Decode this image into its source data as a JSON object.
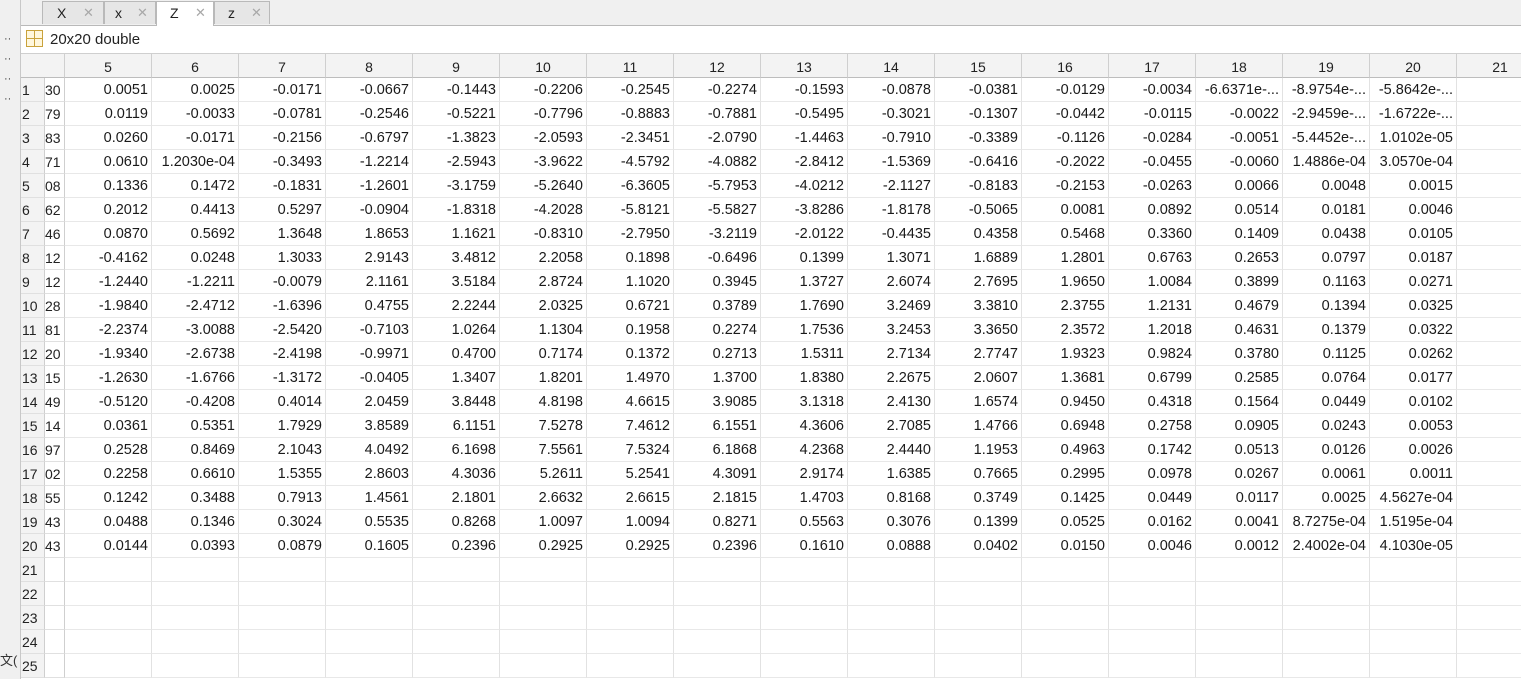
{
  "tabs": [
    {
      "label": "X",
      "active": false
    },
    {
      "label": "x",
      "active": false
    },
    {
      "label": "Z",
      "active": true
    },
    {
      "label": "z",
      "active": false
    }
  ],
  "variable": {
    "description": "20x20 double"
  },
  "left_panel": {
    "partial_label": "文("
  },
  "columns": [
    "5",
    "6",
    "7",
    "8",
    "9",
    "10",
    "11",
    "12",
    "13",
    "14",
    "15",
    "16",
    "17",
    "18",
    "19",
    "20",
    "21"
  ],
  "row_headers": [
    "1",
    "2",
    "3",
    "4",
    "5",
    "6",
    "7",
    "8",
    "9",
    "10",
    "11",
    "12",
    "13",
    "14",
    "15",
    "16",
    "17",
    "18",
    "19",
    "20",
    "21",
    "22",
    "23",
    "24",
    "25"
  ],
  "fragment_column": [
    "30",
    "79",
    "83",
    "71",
    "08",
    "62",
    "46",
    "12",
    "12",
    "28",
    "81",
    "20",
    "15",
    "49",
    "14",
    "97",
    "02",
    "55",
    "43",
    "43",
    "",
    "",
    "",
    "",
    ""
  ],
  "rows": [
    [
      "0.0051",
      "0.0025",
      "-0.0171",
      "-0.0667",
      "-0.1443",
      "-0.2206",
      "-0.2545",
      "-0.2274",
      "-0.1593",
      "-0.0878",
      "-0.0381",
      "-0.0129",
      "-0.0034",
      "-6.6371e-...",
      "-8.9754e-...",
      "-5.8642e-...",
      ""
    ],
    [
      "0.0119",
      "-0.0033",
      "-0.0781",
      "-0.2546",
      "-0.5221",
      "-0.7796",
      "-0.8883",
      "-0.7881",
      "-0.5495",
      "-0.3021",
      "-0.1307",
      "-0.0442",
      "-0.0115",
      "-0.0022",
      "-2.9459e-...",
      "-1.6722e-...",
      ""
    ],
    [
      "0.0260",
      "-0.0171",
      "-0.2156",
      "-0.6797",
      "-1.3823",
      "-2.0593",
      "-2.3451",
      "-2.0790",
      "-1.4463",
      "-0.7910",
      "-0.3389",
      "-0.1126",
      "-0.0284",
      "-0.0051",
      "-5.4452e-...",
      "1.0102e-05",
      ""
    ],
    [
      "0.0610",
      "1.2030e-04",
      "-0.3493",
      "-1.2214",
      "-2.5943",
      "-3.9622",
      "-4.5792",
      "-4.0882",
      "-2.8412",
      "-1.5369",
      "-0.6416",
      "-0.2022",
      "-0.0455",
      "-0.0060",
      "1.4886e-04",
      "3.0570e-04",
      ""
    ],
    [
      "0.1336",
      "0.1472",
      "-0.1831",
      "-1.2601",
      "-3.1759",
      "-5.2640",
      "-6.3605",
      "-5.7953",
      "-4.0212",
      "-2.1127",
      "-0.8183",
      "-0.2153",
      "-0.0263",
      "0.0066",
      "0.0048",
      "0.0015",
      ""
    ],
    [
      "0.2012",
      "0.4413",
      "0.5297",
      "-0.0904",
      "-1.8318",
      "-4.2028",
      "-5.8121",
      "-5.5827",
      "-3.8286",
      "-1.8178",
      "-0.5065",
      "0.0081",
      "0.0892",
      "0.0514",
      "0.0181",
      "0.0046",
      ""
    ],
    [
      "0.0870",
      "0.5692",
      "1.3648",
      "1.8653",
      "1.1621",
      "-0.8310",
      "-2.7950",
      "-3.2119",
      "-2.0122",
      "-0.4435",
      "0.4358",
      "0.5468",
      "0.3360",
      "0.1409",
      "0.0438",
      "0.0105",
      ""
    ],
    [
      "-0.4162",
      "0.0248",
      "1.3033",
      "2.9143",
      "3.4812",
      "2.2058",
      "0.1898",
      "-0.6496",
      "0.1399",
      "1.3071",
      "1.6889",
      "1.2801",
      "0.6763",
      "0.2653",
      "0.0797",
      "0.0187",
      ""
    ],
    [
      "-1.2440",
      "-1.2211",
      "-0.0079",
      "2.1161",
      "3.5184",
      "2.8724",
      "1.1020",
      "0.3945",
      "1.3727",
      "2.6074",
      "2.7695",
      "1.9650",
      "1.0084",
      "0.3899",
      "0.1163",
      "0.0271",
      ""
    ],
    [
      "-1.9840",
      "-2.4712",
      "-1.6396",
      "0.4755",
      "2.2244",
      "2.0325",
      "0.6721",
      "0.3789",
      "1.7690",
      "3.2469",
      "3.3810",
      "2.3755",
      "1.2131",
      "0.4679",
      "0.1394",
      "0.0325",
      ""
    ],
    [
      "-2.2374",
      "-3.0088",
      "-2.5420",
      "-0.7103",
      "1.0264",
      "1.1304",
      "0.1958",
      "0.2274",
      "1.7536",
      "3.2453",
      "3.3650",
      "2.3572",
      "1.2018",
      "0.4631",
      "0.1379",
      "0.0322",
      ""
    ],
    [
      "-1.9340",
      "-2.6738",
      "-2.4198",
      "-0.9971",
      "0.4700",
      "0.7174",
      "0.1372",
      "0.2713",
      "1.5311",
      "2.7134",
      "2.7747",
      "1.9323",
      "0.9824",
      "0.3780",
      "0.1125",
      "0.0262",
      ""
    ],
    [
      "-1.2630",
      "-1.6766",
      "-1.3172",
      "-0.0405",
      "1.3407",
      "1.8201",
      "1.4970",
      "1.3700",
      "1.8380",
      "2.2675",
      "2.0607",
      "1.3681",
      "0.6799",
      "0.2585",
      "0.0764",
      "0.0177",
      ""
    ],
    [
      "-0.5120",
      "-0.4208",
      "0.4014",
      "2.0459",
      "3.8448",
      "4.8198",
      "4.6615",
      "3.9085",
      "3.1318",
      "2.4130",
      "1.6574",
      "0.9450",
      "0.4318",
      "0.1564",
      "0.0449",
      "0.0102",
      ""
    ],
    [
      "0.0361",
      "0.5351",
      "1.7929",
      "3.8589",
      "6.1151",
      "7.5278",
      "7.4612",
      "6.1551",
      "4.3606",
      "2.7085",
      "1.4766",
      "0.6948",
      "0.2758",
      "0.0905",
      "0.0243",
      "0.0053",
      ""
    ],
    [
      "0.2528",
      "0.8469",
      "2.1043",
      "4.0492",
      "6.1698",
      "7.5561",
      "7.5324",
      "6.1868",
      "4.2368",
      "2.4440",
      "1.1953",
      "0.4963",
      "0.1742",
      "0.0513",
      "0.0126",
      "0.0026",
      ""
    ],
    [
      "0.2258",
      "0.6610",
      "1.5355",
      "2.8603",
      "4.3036",
      "5.2611",
      "5.2541",
      "4.3091",
      "2.9174",
      "1.6385",
      "0.7665",
      "0.2995",
      "0.0978",
      "0.0267",
      "0.0061",
      "0.0011",
      ""
    ],
    [
      "0.1242",
      "0.3488",
      "0.7913",
      "1.4561",
      "2.1801",
      "2.6632",
      "2.6615",
      "2.1815",
      "1.4703",
      "0.8168",
      "0.3749",
      "0.1425",
      "0.0449",
      "0.0117",
      "0.0025",
      "4.5627e-04",
      ""
    ],
    [
      "0.0488",
      "0.1346",
      "0.3024",
      "0.5535",
      "0.8268",
      "1.0097",
      "1.0094",
      "0.8271",
      "0.5563",
      "0.3076",
      "0.1399",
      "0.0525",
      "0.0162",
      "0.0041",
      "8.7275e-04",
      "1.5195e-04",
      ""
    ],
    [
      "0.0144",
      "0.0393",
      "0.0879",
      "0.1605",
      "0.2396",
      "0.2925",
      "0.2925",
      "0.2396",
      "0.1610",
      "0.0888",
      "0.0402",
      "0.0150",
      "0.0046",
      "0.0012",
      "2.4002e-04",
      "4.1030e-05",
      ""
    ],
    [
      "",
      "",
      "",
      "",
      "",
      "",
      "",
      "",
      "",
      "",
      "",
      "",
      "",
      "",
      "",
      "",
      ""
    ],
    [
      "",
      "",
      "",
      "",
      "",
      "",
      "",
      "",
      "",
      "",
      "",
      "",
      "",
      "",
      "",
      "",
      ""
    ],
    [
      "",
      "",
      "",
      "",
      "",
      "",
      "",
      "",
      "",
      "",
      "",
      "",
      "",
      "",
      "",
      "",
      ""
    ],
    [
      "",
      "",
      "",
      "",
      "",
      "",
      "",
      "",
      "",
      "",
      "",
      "",
      "",
      "",
      "",
      "",
      ""
    ],
    [
      "",
      "",
      "",
      "",
      "",
      "",
      "",
      "",
      "",
      "",
      "",
      "",
      "",
      "",
      "",
      "",
      ""
    ]
  ]
}
